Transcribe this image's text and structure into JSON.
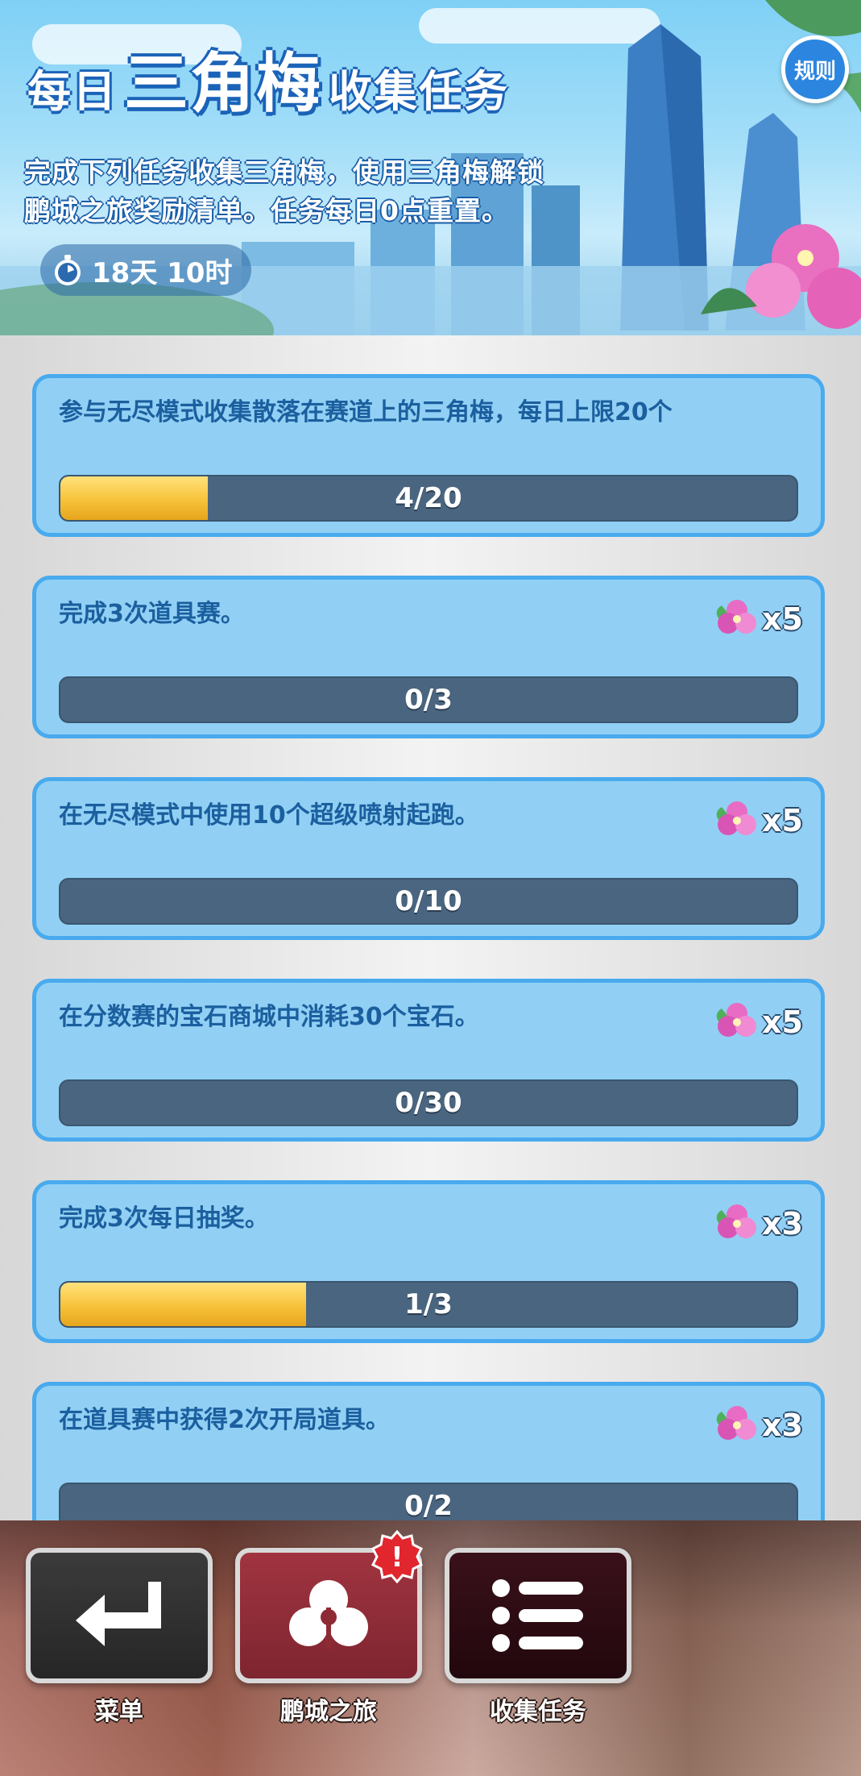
{
  "header": {
    "title_prefix": "每日",
    "title_highlight": "三角梅",
    "title_suffix": "收集任务",
    "description_line1": "完成下列任务收集三角梅，使用三角梅解锁",
    "description_line2": "鹏城之旅奖励清单。任务每日0点重置。",
    "countdown": "18天 10时",
    "rules_label": "规则"
  },
  "tasks": [
    {
      "title": "参与无尽模式收集散落在赛道上的三角梅，每日上限20个",
      "progress_text": "4/20",
      "progress": 0.2,
      "reward": ""
    },
    {
      "title": "完成3次道具赛。",
      "progress_text": "0/3",
      "progress": 0,
      "reward": "x5"
    },
    {
      "title": "在无尽模式中使用10个超级喷射起跑。",
      "progress_text": "0/10",
      "progress": 0,
      "reward": "x5"
    },
    {
      "title": "在分数赛的宝石商城中消耗30个宝石。",
      "progress_text": "0/30",
      "progress": 0,
      "reward": "x5"
    },
    {
      "title": "完成3次每日抽奖。",
      "progress_text": "1/3",
      "progress": 0.3333,
      "reward": "x3"
    },
    {
      "title": "在道具赛中获得2次开局道具。",
      "progress_text": "0/2",
      "progress": 0,
      "reward": "x3"
    }
  ],
  "bottom_nav": {
    "menu_label": "菜单",
    "journey_label": "鹏城之旅",
    "tasks_label": "收集任务",
    "journey_alert": "!"
  },
  "colors": {
    "card_bg": "#91d0f4",
    "card_border": "#49aaee",
    "task_text": "#1b5f9f",
    "progress_track": "#4a657f",
    "progress_fill": "#f7c23a",
    "menu_btn": "#333333",
    "journey_btn": "#8e2a34",
    "tasks_btn": "#2c0d14"
  },
  "icons": {
    "reward": "bougainvillea-flower-icon",
    "timer": "stopwatch-icon",
    "menu": "return-arrow-icon",
    "journey": "bougainvillea-emblem-icon",
    "tasks": "list-icon",
    "alert": "exclamation-badge-icon"
  }
}
